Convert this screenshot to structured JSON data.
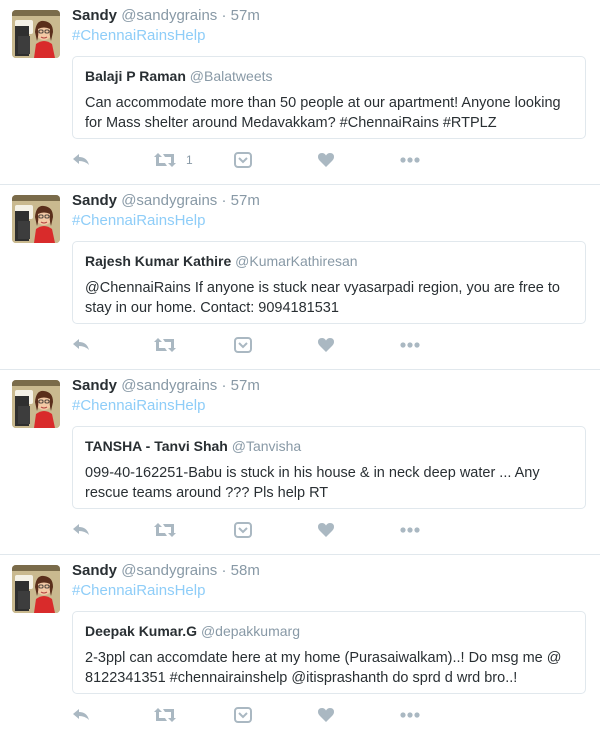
{
  "tweets": [
    {
      "user_name": "Sandy",
      "user_handle": "@sandygrains",
      "separator": "·",
      "time": "57m",
      "hashtag": "#ChennaiRainsHelp",
      "quote": {
        "author_name": "Balaji P Raman",
        "author_handle": "@Balatweets",
        "text": "Can accommodate more than 50 people at our apartment! Anyone looking for Mass shelter around Medavakkam? #ChennaiRains #RTPLZ"
      },
      "retweet_count": "1"
    },
    {
      "user_name": "Sandy",
      "user_handle": "@sandygrains",
      "separator": "·",
      "time": "57m",
      "hashtag": "#ChennaiRainsHelp",
      "quote": {
        "author_name": "Rajesh Kumar Kathire",
        "author_handle": "@KumarKathiresan",
        "text": "@ChennaiRains If anyone is stuck near vyasarpadi region, you are free to stay in our home. Contact: 9094181531"
      },
      "retweet_count": ""
    },
    {
      "user_name": "Sandy",
      "user_handle": "@sandygrains",
      "separator": "·",
      "time": "57m",
      "hashtag": "#ChennaiRainsHelp",
      "quote": {
        "author_name": "TANSHA - Tanvi Shah",
        "author_handle": "@Tanvisha",
        "text": "099-40-162251-Babu is stuck in his house & in neck deep water ... Any rescue teams around ??? Pls help RT"
      },
      "retweet_count": ""
    },
    {
      "user_name": "Sandy",
      "user_handle": "@sandygrains",
      "separator": "·",
      "time": "58m",
      "hashtag": "#ChennaiRainsHelp",
      "quote": {
        "author_name": "Deepak Kumar.G",
        "author_handle": "@depakkumarg",
        "text": "2-3ppl can accomdate here at my home (Purasaiwalkam)..! Do msg me @ 8122341351  #chennairainshelp @itisprashanth  do sprd d wrd bro..!"
      },
      "retweet_count": ""
    }
  ],
  "icons": {
    "reply": "reply-icon",
    "retweet": "retweet-icon",
    "moment": "moment-icon",
    "like": "heart-icon",
    "more": "more-icon"
  },
  "colors": {
    "icon": "#aab8c2",
    "hashtag": "#8ecdf8",
    "handle": "#8899a6",
    "border": "#e1e8ed"
  }
}
